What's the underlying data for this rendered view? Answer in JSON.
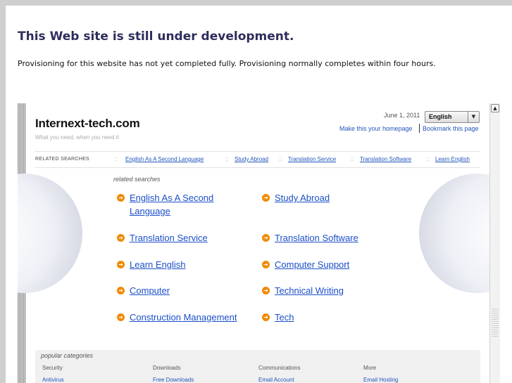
{
  "notice": {
    "title": "This Web site is still under development.",
    "text": "Provisioning for this website has not yet completed fully. Provisioning normally completes within four hours."
  },
  "site": {
    "title": "Internext-tech.com",
    "tagline": "What you need, when you need it",
    "date": "June 1, 2011",
    "language": "English",
    "homepage_link": "Make this your homepage",
    "bookmark_link": "Bookmark this page"
  },
  "related_bar": {
    "label": "RELATED SEARCHES",
    "separator": "::",
    "links": [
      "English As A Second Language",
      "Study Abroad",
      "Translation Service",
      "Translation Software",
      "Learn English"
    ]
  },
  "related_searches": {
    "heading": "related searches",
    "items": [
      [
        "English As A Second",
        "Language"
      ],
      [
        "Study Abroad"
      ],
      [
        "Translation Service"
      ],
      [
        "Translation Software"
      ],
      [
        "Learn English"
      ],
      [
        "Computer Support"
      ],
      [
        "Computer"
      ],
      [
        "Technical Writing"
      ],
      [
        "Construction Management"
      ],
      [
        "Tech"
      ]
    ]
  },
  "popular": {
    "heading": "popular categories",
    "categories": [
      {
        "name": "Security",
        "link": "Antivirus"
      },
      {
        "name": "Downloads",
        "link": "Free Downloads"
      },
      {
        "name": "Communications",
        "link": "Email Account"
      },
      {
        "name": "More",
        "link": "Email Hosting"
      }
    ]
  },
  "icons": {
    "result_arrow": "circle-arrow-right-icon",
    "select_arrow": "triangle-down-icon",
    "scroll_up": "triangle-up-icon"
  },
  "colors": {
    "notice_title": "#2e2e5c",
    "link": "#1b4fc9",
    "arrow_icon": "#f08a00"
  }
}
